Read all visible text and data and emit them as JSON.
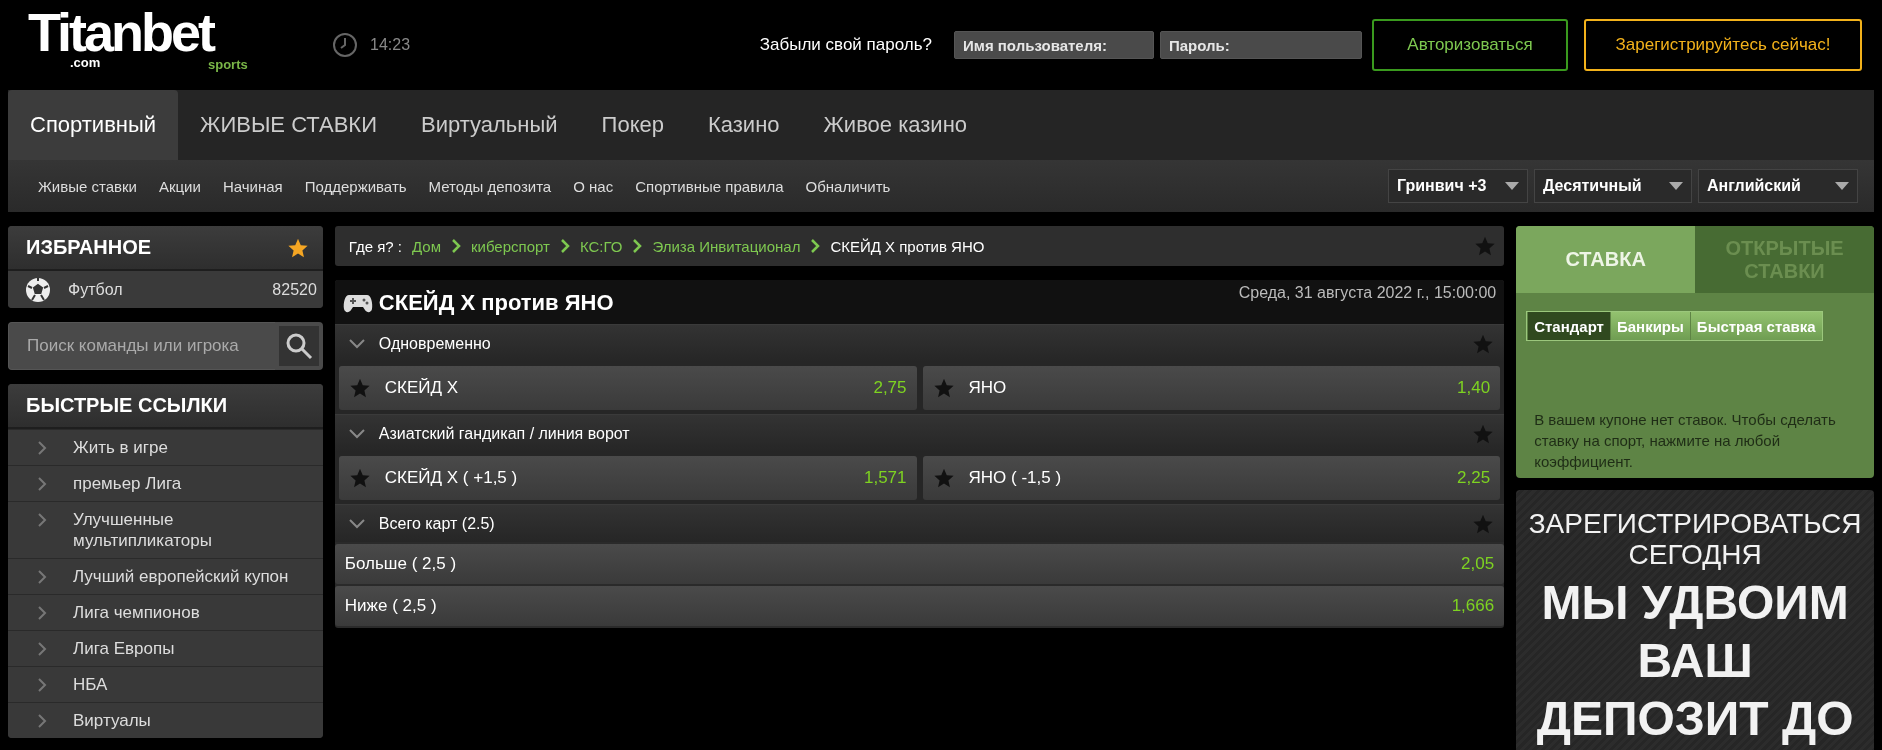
{
  "header": {
    "logo": {
      "name": "Titanbet",
      "domain": ".com",
      "tagline": "sports"
    },
    "time": "14:23",
    "forgot": "Забыли свой пароль?",
    "username": {
      "placeholder": "Имя пользователя:"
    },
    "password": {
      "placeholder": "Пароль:"
    },
    "login": "Авторизоваться",
    "register": "Зарегистрируйтесь сейчас!"
  },
  "nav_tabs": [
    {
      "label": "Спортивный",
      "selected": true
    },
    {
      "label": "ЖИВЫЕ СТАВКИ",
      "selected": false
    },
    {
      "label": "Виртуальный",
      "selected": false
    },
    {
      "label": "Покер",
      "selected": false
    },
    {
      "label": "Казино",
      "selected": false
    },
    {
      "label": "Живое казино",
      "selected": false
    }
  ],
  "sub_nav": [
    "Живые ставки",
    "Акции",
    "Начиная",
    "Поддерживать",
    "Методы депозита",
    "О нас",
    "Спортивные правила",
    "Обналичить"
  ],
  "selectors": [
    "Гринвич +3",
    "Десятичный",
    "Английский"
  ],
  "favorites": {
    "title": "ИЗБРАННОЕ",
    "items": [
      {
        "name": "Футбол",
        "count": "82520"
      }
    ]
  },
  "search": {
    "placeholder": "Поиск команды или игрока"
  },
  "quick_links": {
    "title": "БЫСТРЫЕ ССЫЛКИ",
    "items": [
      "Жить в игре",
      "премьер Лига",
      "Улучшенные мультипликаторы",
      "Лучший европейский купон",
      "Лига чемпионов",
      "Лига Европы",
      "НБА",
      "Виртуалы"
    ]
  },
  "breadcrumb": {
    "label": "Где я? :",
    "items": [
      "Дом",
      "киберспорт",
      "КС:ГО",
      "Элиза Инвитационал",
      "СКЕЙД Х против ЯНО"
    ]
  },
  "event": {
    "title": "СКЕЙД Х против ЯНО",
    "date": "Среда, 31 августа 2022 г., 15:00:00",
    "markets": [
      {
        "name": "Одновременно",
        "kind": "pair",
        "selections": [
          {
            "label": "СКЕЙД Х",
            "odds": "2,75"
          },
          {
            "label": "ЯНО",
            "odds": "1,40"
          }
        ]
      },
      {
        "name": "Азиатский гандикап / линия ворот",
        "kind": "pair",
        "selections": [
          {
            "label": "СКЕЙД Х ( +1,5 )",
            "odds": "1,571"
          },
          {
            "label": "ЯНО ( -1,5 )",
            "odds": "2,25"
          }
        ]
      },
      {
        "name": "Всего карт (2.5)",
        "kind": "list",
        "selections": [
          {
            "label": "Больше ( 2,5 )",
            "odds": "2,05"
          },
          {
            "label": "Ниже ( 2,5 )",
            "odds": "1,666"
          }
        ]
      }
    ]
  },
  "betslip": {
    "tabs": [
      {
        "label": "СТАВКА",
        "selected": true
      },
      {
        "label": "ОТКРЫТЫЕ СТАВКИ",
        "selected": false
      }
    ],
    "modes": [
      {
        "label": "Стандарт",
        "selected": true
      },
      {
        "label": "Банкиры",
        "selected": false
      },
      {
        "label": "Быстрая ставка",
        "selected": false
      }
    ],
    "message": "В вашем купоне нет ставок. Чтобы сделать ставку на спорт, нажмите на любой коэффициент."
  },
  "promo": {
    "lines": [
      {
        "text": "ЗАРЕГИСТРИРОВАТЬСЯ СЕГОДНЯ",
        "kind": "small"
      },
      {
        "text": "МЫ УДВОИМ ВАШ ДЕПОЗИТ ДО",
        "kind": "large"
      }
    ]
  }
}
